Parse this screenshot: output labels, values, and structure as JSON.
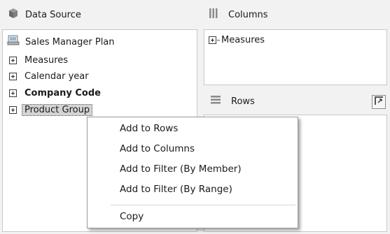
{
  "data_source": {
    "header": "Data Source",
    "header_icon": "cube-icon",
    "root": {
      "label": "Sales Manager Plan",
      "icon": "database-icon"
    },
    "items": [
      {
        "label": "Measures",
        "bold": false,
        "selected": false
      },
      {
        "label": "Calendar year",
        "bold": false,
        "selected": false
      },
      {
        "label": "Company Code",
        "bold": true,
        "selected": false
      },
      {
        "label": "Product Group",
        "bold": false,
        "selected": true
      }
    ]
  },
  "columns": {
    "header": "Columns",
    "header_icon": "columns-icon",
    "items": [
      {
        "label": "Measures"
      }
    ]
  },
  "rows": {
    "header": "Rows",
    "header_icon": "rows-icon",
    "swap_icon": "swap-axes-icon"
  },
  "context_menu": {
    "items": [
      {
        "label": "Add to Rows"
      },
      {
        "label": "Add to Columns"
      },
      {
        "label": "Add to Filter (By Member)"
      },
      {
        "label": "Add to Filter (By Range)"
      },
      {
        "label": "Copy"
      }
    ]
  },
  "colors": {
    "selection_bg": "#d4d4d4",
    "pane_bg": "#f2f2f2",
    "border": "#c8c8c8"
  }
}
